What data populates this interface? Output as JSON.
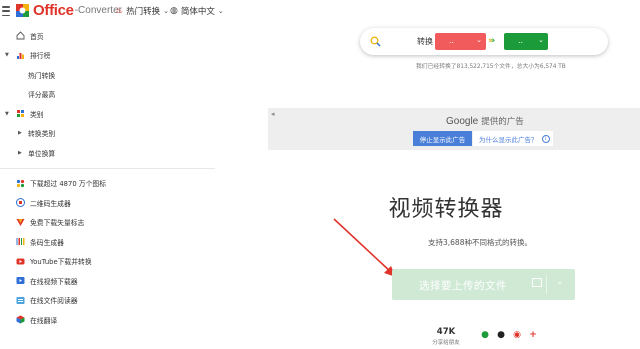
{
  "header": {
    "logo_text": "Office",
    "logo_sub": "-Converter",
    "nav_hot": "热门转换",
    "nav_lang": "简体中文"
  },
  "sidebar": {
    "items": [
      {
        "label": "首页",
        "icon": "home-icon"
      },
      {
        "label": "排行榜",
        "icon": "chart-icon"
      },
      {
        "label": "热门转换"
      },
      {
        "label": "评分最高"
      },
      {
        "label": "类别",
        "icon": "grid-icon"
      },
      {
        "label": "转换类别"
      },
      {
        "label": "单位换算"
      }
    ],
    "tools": [
      {
        "label": "下载超过 4870 万个图标",
        "icon": "icons8-icon"
      },
      {
        "label": "二维码生成器",
        "icon": "qr-icon"
      },
      {
        "label": "免费下载矢量标志",
        "icon": "vector-icon"
      },
      {
        "label": "条码生成器",
        "icon": "barcode-icon"
      },
      {
        "label": "YouTube下载并转换",
        "icon": "youtube-icon"
      },
      {
        "label": "在线视频下载器",
        "icon": "video-download-icon"
      },
      {
        "label": "在线文件阅读器",
        "icon": "file-reader-icon"
      },
      {
        "label": "在线翻译",
        "icon": "translate-icon"
      }
    ]
  },
  "converter": {
    "label": "转换",
    "from_value": "..",
    "to_value": "..",
    "stats": "我们已经转换了813,522,715个文件，总大小为6,574 TB"
  },
  "ad": {
    "google": "Google",
    "provided": "提供的广告",
    "stop": "停止显示此广告",
    "why": "为什么显示此广告？"
  },
  "main": {
    "title": "视频转换器",
    "subtitle": "支持3,688种不同格式的转换。",
    "upload": "选择要上传的文件"
  },
  "share": {
    "count": "47K",
    "label": "分享给朋友"
  },
  "colors": {
    "brand_red": "#e0342a",
    "from_red": "#f25b5b",
    "to_green": "#1c9b3a",
    "upload_green": "#cfe9d4",
    "ad_blue": "#4a7fd9"
  }
}
